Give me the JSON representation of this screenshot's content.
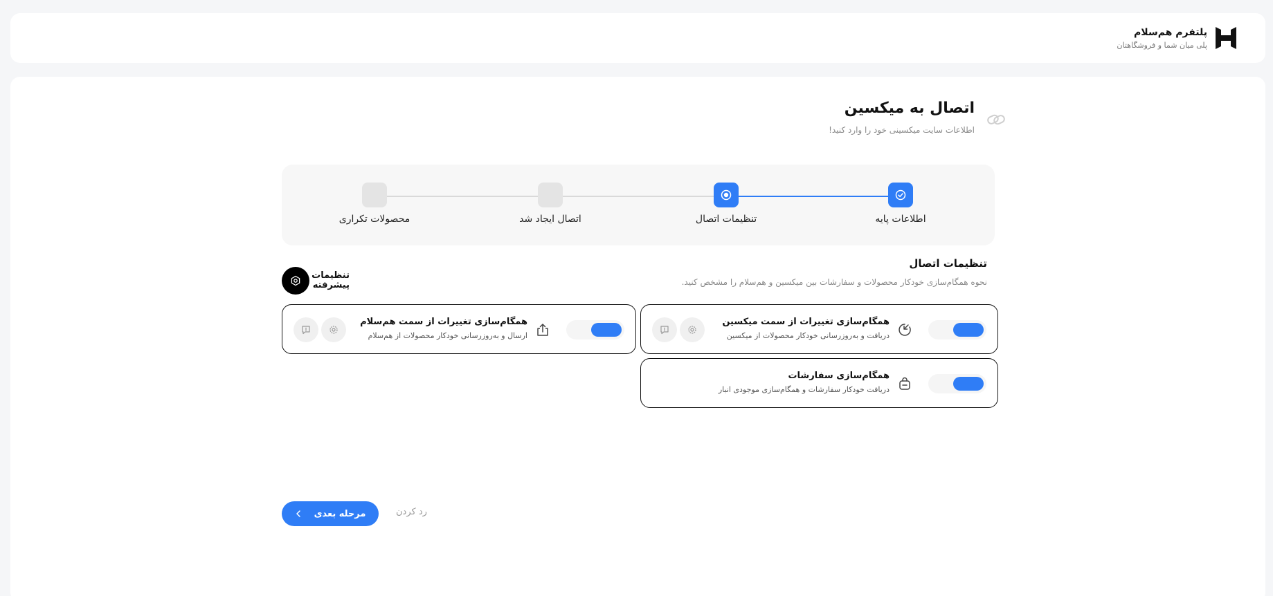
{
  "header": {
    "brand_name": "پلتفرم هم‌سلام",
    "brand_tagline": "پلی میان شما و فروشگاهتان"
  },
  "page": {
    "title": "اتصال به میکسین",
    "subtitle": "اطلاعات سایت میکسینی خود را وارد کنید!"
  },
  "steps": [
    {
      "label": "اطلاعات پایه",
      "state": "done"
    },
    {
      "label": "تنظیمات اتصال",
      "state": "current"
    },
    {
      "label": "اتصال ایجاد شد",
      "state": "pending"
    },
    {
      "label": "محصولات تکراری",
      "state": "pending"
    }
  ],
  "settings": {
    "title": "تنظیمات اتصال",
    "description": "نحوه همگام‌سازی خودکار محصولات و سفارشات بین میکسین و هم‌سلام را مشخص کنید.",
    "advanced_label": "تنظیمات پیشرفته"
  },
  "cards": [
    {
      "title": "همگام‌سازی تغییرات از سمت میکسین",
      "description": "دریافت و به‌روزرسانی خودکار محصولات از میکسین",
      "enabled": true,
      "icon": "sync-in-icon"
    },
    {
      "title": "همگام‌سازی تغییرات از سمت هم‌سلام",
      "description": "ارسال و به‌روزرسانی خودکار محصولات از هم‌سلام",
      "enabled": true,
      "icon": "upload-icon"
    },
    {
      "title": "همگام‌سازی سفارشات",
      "description": "دریافت خودکار سفارشات و همگام‌سازی موجودی انبار",
      "enabled": true,
      "icon": "bag-icon"
    }
  ],
  "actions": {
    "next_label": "مرحله بعدی",
    "skip_label": "رد کردن"
  },
  "colors": {
    "accent": "#2f7df6",
    "step_pending": "#e4e4e4"
  }
}
